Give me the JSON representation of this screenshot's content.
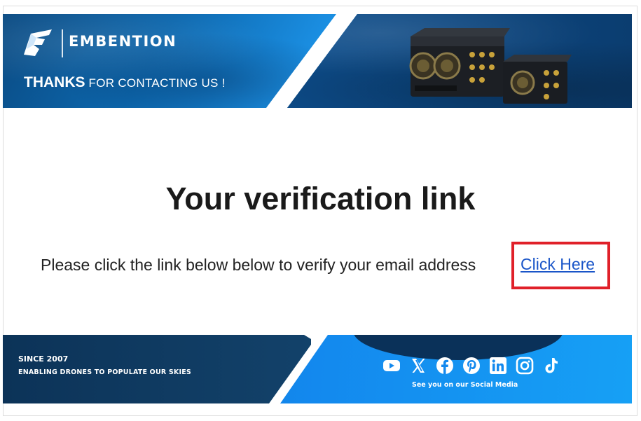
{
  "header": {
    "brand_name": "EMBENTION",
    "thanks_bold": "THANKS",
    "thanks_rest": " FOR CONTACTING US !"
  },
  "main": {
    "title": "Your verification link",
    "instruction": "Please click the link below below to verify your email address",
    "link_label": "Click Here"
  },
  "footer": {
    "since": "SINCE 2007",
    "tagline": "ENABLING DRONES TO POPULATE OUR SKIES",
    "social_caption": "See you on our Social Media",
    "social_icons": [
      "youtube-icon",
      "x-icon",
      "facebook-icon",
      "pinterest-icon",
      "linkedin-icon",
      "instagram-icon",
      "tiktok-icon"
    ]
  },
  "colors": {
    "highlight_box": "#e02029",
    "link": "#1a55c8",
    "brand_blue": "#0d67ad"
  }
}
